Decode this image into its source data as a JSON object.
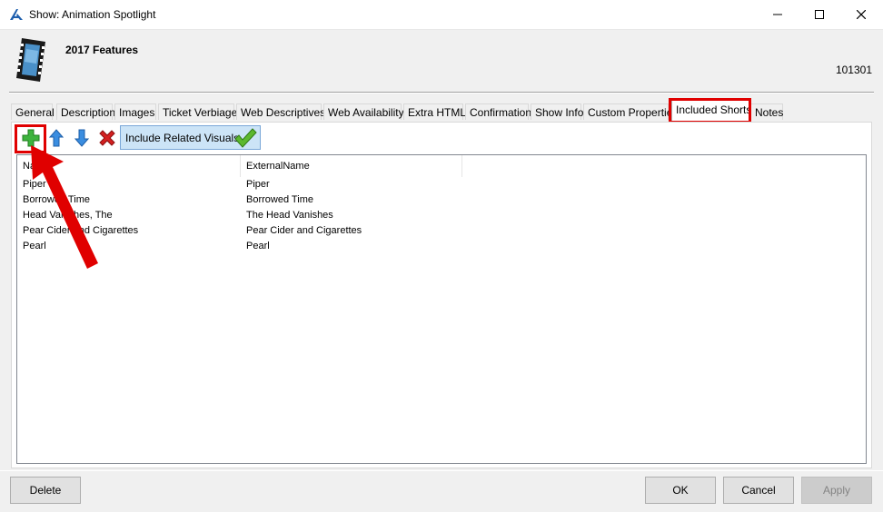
{
  "window": {
    "title": "Show: Animation Spotlight",
    "minimize_glyph": "—",
    "maximize_glyph": "☐",
    "close_glyph": "✕"
  },
  "header": {
    "show_name": "2017 Features",
    "show_id": "101301",
    "icon": "film-strip-icon"
  },
  "tabs": [
    {
      "label": "General"
    },
    {
      "label": "Description"
    },
    {
      "label": "Images"
    },
    {
      "label": "Ticket Verbiage"
    },
    {
      "label": "Web Descriptives"
    },
    {
      "label": "Web Availability"
    },
    {
      "label": "Extra HTML"
    },
    {
      "label": "Confirmation"
    },
    {
      "label": "Show Info"
    },
    {
      "label": "Custom Properties"
    },
    {
      "label": "Included Shorts",
      "active": true
    },
    {
      "label": "Notes"
    }
  ],
  "toolbar": {
    "include_related_label": "Include Related Visuals",
    "icons": [
      "add-icon",
      "move-up-icon",
      "move-down-icon",
      "delete-icon",
      "checkmark-icon"
    ]
  },
  "list": {
    "columns": [
      "Name",
      "ExternalName"
    ],
    "rows": [
      {
        "name": "Piper",
        "external": "Piper"
      },
      {
        "name": "Borrowed Time",
        "external": "Borrowed Time"
      },
      {
        "name": "Head Vanishes, The",
        "external": "The Head Vanishes"
      },
      {
        "name": "Pear Cider and Cigarettes",
        "external": "Pear Cider and Cigarettes"
      },
      {
        "name": "Pearl",
        "external": "Pearl"
      }
    ]
  },
  "buttons": {
    "delete": "Delete",
    "ok": "OK",
    "cancel": "Cancel",
    "apply": "Apply"
  },
  "colors": {
    "highlight": "#e00000",
    "selected_button": "#cce4f7"
  }
}
